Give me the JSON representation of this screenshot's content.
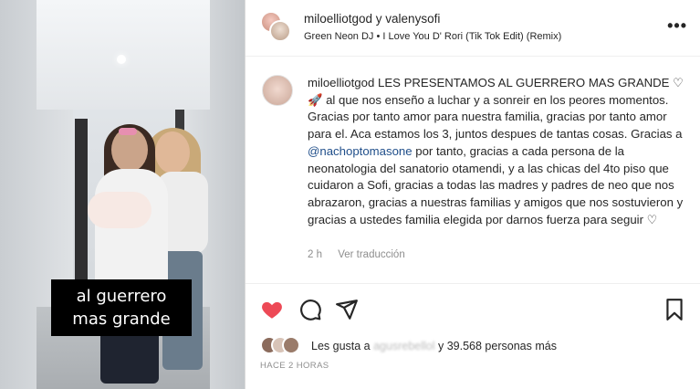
{
  "media": {
    "caption_line1": "al guerrero",
    "caption_line2": "mas grande"
  },
  "header": {
    "owner": "miloelliotgod y valenysofi",
    "audio": "Green Neon DJ • I Love You D' Rori (Tik Tok Edit) (Remix)",
    "more_label": "•••"
  },
  "comment": {
    "username": "miloelliotgod",
    "text_part1": "LES PRESENTAMOS AL GUERRERO MAS GRANDE ♡🚀 al que nos enseño a luchar y a sonreir en los peores momentos. Gracias por tanto amor para nuestra familia, gracias por tanto amor para el. Aca estamos los 3, juntos despues de tantas cosas. Gracias a ",
    "mention": "@nachoptomasone",
    "text_part2": " por tanto, gracias a cada persona de la neonatologia del sanatorio otamendi, y a las chicas del 4to piso que cuidaron a Sofi, gracias a todas las madres y padres de neo que nos abrazaron, gracias a nuestras familias y amigos que nos sostuvieron y gracias a ustedes familia elegida por darnos fuerza para seguir ♡",
    "time": "2 h",
    "translate": "Ver traducción"
  },
  "likes": {
    "prefix": "Les gusta a ",
    "hidden_name": "agusrebellol",
    "suffix": " y 39.568 personas más"
  },
  "timestamp": "HACE 2 HORAS",
  "colors": {
    "heart": "#ed4956",
    "text": "#262626",
    "muted": "#8e8e8e",
    "mention": "#1f4e8a"
  },
  "icons": [
    "heart-icon",
    "comment-icon",
    "share-icon",
    "bookmark-icon",
    "more-icon"
  ]
}
